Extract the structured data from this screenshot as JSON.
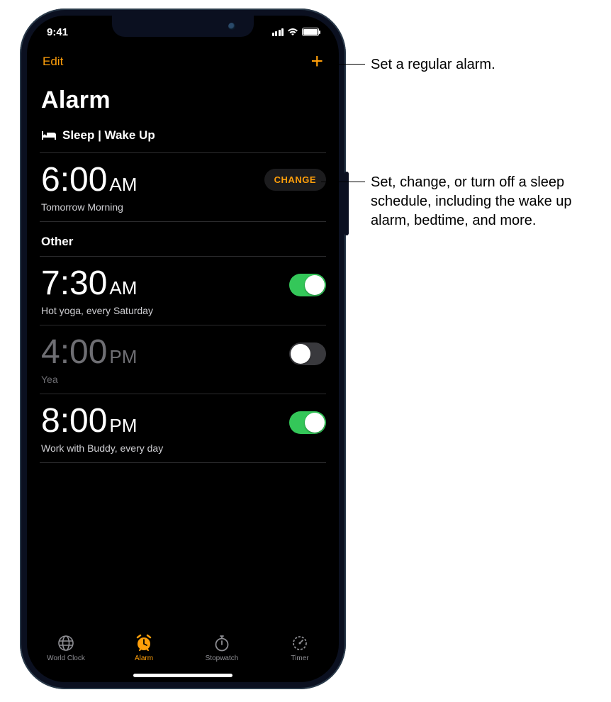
{
  "status": {
    "time": "9:41"
  },
  "nav": {
    "edit": "Edit",
    "add": "+"
  },
  "page": {
    "title": "Alarm"
  },
  "sleep": {
    "header": "Sleep | Wake Up",
    "time": "6:00",
    "ampm": "AM",
    "sub": "Tomorrow Morning",
    "change": "CHANGE"
  },
  "other": {
    "header": "Other",
    "alarms": [
      {
        "time": "7:30",
        "ampm": "AM",
        "sub": "Hot yoga, every Saturday",
        "on": true
      },
      {
        "time": "4:00",
        "ampm": "PM",
        "sub": "Yea",
        "on": false
      },
      {
        "time": "8:00",
        "ampm": "PM",
        "sub": "Work with Buddy, every day",
        "on": true
      }
    ]
  },
  "tabs": [
    {
      "label": "World Clock",
      "active": false
    },
    {
      "label": "Alarm",
      "active": true
    },
    {
      "label": "Stopwatch",
      "active": false
    },
    {
      "label": "Timer",
      "active": false
    }
  ],
  "callouts": {
    "add": "Set a regular alarm.",
    "change": "Set, change, or turn off a sleep schedule, including the wake up alarm, bedtime, and more."
  }
}
